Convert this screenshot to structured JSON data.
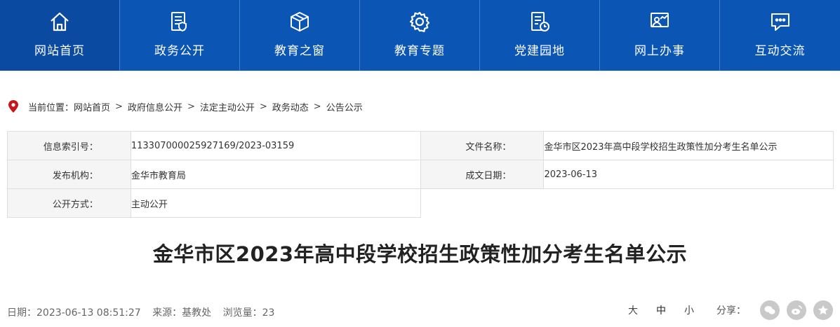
{
  "nav": {
    "items": [
      {
        "label": "网站首页",
        "icon": "home-icon",
        "active": true
      },
      {
        "label": "政务公开",
        "icon": "document-shield-icon",
        "active": false
      },
      {
        "label": "教育之窗",
        "icon": "box-icon",
        "active": false
      },
      {
        "label": "教育专题",
        "icon": "gear-icon",
        "active": false
      },
      {
        "label": "党建园地",
        "icon": "document-clock-icon",
        "active": false
      },
      {
        "label": "网上办事",
        "icon": "person-chart-icon",
        "active": false
      },
      {
        "label": "互动交流",
        "icon": "chat-bubble-icon",
        "active": false
      }
    ],
    "bg_color": "#0b56b4"
  },
  "breadcrumb": {
    "prefix": "当前位置：",
    "items": [
      "网站首页",
      "政府信息公开",
      "法定主动公开",
      "政务动态",
      "公告公示"
    ],
    "separator": ">"
  },
  "info": {
    "index_label": "信息索引号：",
    "index_value": "113307000025927169/2023-03159",
    "filename_label": "文件名称：",
    "filename_value": "金华市区2023年高中段学校招生政策性加分考生名单公示",
    "issuer_label": "发布机构：",
    "issuer_value": "金华市教育局",
    "date_label": "成文日期：",
    "date_value": "2023-06-13",
    "mode_label": "公开方式：",
    "mode_value": "主动公开"
  },
  "article": {
    "title": "金华市区2023年高中段学校招生政策性加分考生名单公示",
    "date": "日期：2023-06-13 08:51:27",
    "source": "来源：基教处",
    "views": "浏览量：23"
  },
  "tools": {
    "font_large": "大",
    "font_medium": "中",
    "font_small": "小",
    "share_label": "分享："
  }
}
